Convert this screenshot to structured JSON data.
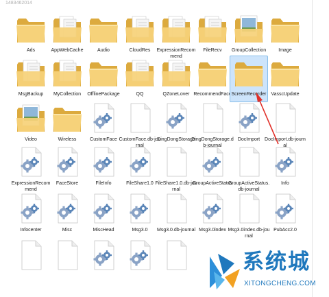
{
  "window": {
    "path_fragment": "1483462014"
  },
  "colors": {
    "folder": "#f4cb6a",
    "folder_dark": "#dcaa3e",
    "selection": "#cde4fb",
    "arrow": "#e0302a",
    "watermark": "#1f78bd"
  },
  "items": [
    {
      "label": "Ads",
      "icon": "folder"
    },
    {
      "label": "AppWebCache",
      "icon": "folder-docs"
    },
    {
      "label": "Audio",
      "icon": "folder"
    },
    {
      "label": "CloudRes",
      "icon": "folder-docs"
    },
    {
      "label": "ExpressionRecommend",
      "icon": "folder-docs"
    },
    {
      "label": "FileRecv",
      "icon": "folder-docs"
    },
    {
      "label": "GroupCollection",
      "icon": "folder-image"
    },
    {
      "label": "Image",
      "icon": "folder"
    },
    {
      "label": "MsgBackup",
      "icon": "folder-docs"
    },
    {
      "label": "MyCollection",
      "icon": "folder-docs"
    },
    {
      "label": "OfflinePackage",
      "icon": "folder"
    },
    {
      "label": "QQ",
      "icon": "folder-docs"
    },
    {
      "label": "QZoneLover",
      "icon": "folder-docs"
    },
    {
      "label": "RecommendFace",
      "icon": "folder"
    },
    {
      "label": "ScreenRecorder",
      "icon": "folder",
      "selected": true
    },
    {
      "label": "VasscUpdate",
      "icon": "folder"
    },
    {
      "label": "Video",
      "icon": "folder-image"
    },
    {
      "label": "Wireless",
      "icon": "folder"
    },
    {
      "label": "CustomFace",
      "icon": "gear-file"
    },
    {
      "label": "CustomFace.db-journal",
      "icon": "blank-file"
    },
    {
      "label": "DingDongStorage",
      "icon": "gear-file"
    },
    {
      "label": "DingDongStorage.db-journal",
      "icon": "blank-file"
    },
    {
      "label": "DocImport",
      "icon": "gear-file"
    },
    {
      "label": "DocImport.db-journal",
      "icon": "blank-file"
    },
    {
      "label": "ExpressionRecommend",
      "icon": "gear-file"
    },
    {
      "label": "FaceStore",
      "icon": "gear-file"
    },
    {
      "label": "FileInfo",
      "icon": "gear-file"
    },
    {
      "label": "FileShare1.0",
      "icon": "gear-file"
    },
    {
      "label": "FileShare1.0.db-journal",
      "icon": "blank-file"
    },
    {
      "label": "GroupActiveStatus",
      "icon": "gear-file"
    },
    {
      "label": "GroupActiveStatus.db-journal",
      "icon": "blank-file"
    },
    {
      "label": "Info",
      "icon": "gear-file"
    },
    {
      "label": "Infocenter",
      "icon": "gear-file"
    },
    {
      "label": "Misc",
      "icon": "gear-file"
    },
    {
      "label": "MiscHead",
      "icon": "gear-file"
    },
    {
      "label": "Msg3.0",
      "icon": "gear-file"
    },
    {
      "label": "Msg3.0.db-journal",
      "icon": "blank-file"
    },
    {
      "label": "Msg3.0index",
      "icon": "gear-file"
    },
    {
      "label": "Msg3.0index.db-journal",
      "icon": "blank-file"
    },
    {
      "label": "PubAcc2.0",
      "icon": "gear-file"
    },
    {
      "label": "",
      "icon": "blank-file"
    },
    {
      "label": "",
      "icon": "blank-file"
    },
    {
      "label": "",
      "icon": "gear-file"
    },
    {
      "label": "",
      "icon": "gear-file"
    },
    {
      "label": "",
      "icon": "blank-file"
    }
  ],
  "watermark": {
    "cn": "系统城",
    "en": "XITONGCHENG.COM"
  }
}
